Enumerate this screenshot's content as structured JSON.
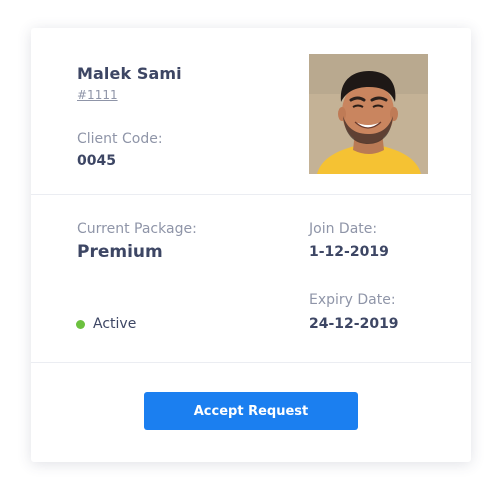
{
  "client": {
    "name": "Malek Sami",
    "id": "#1111",
    "code_label": "Client Code:",
    "code_value": "0045"
  },
  "package": {
    "label": "Current Package:",
    "value": "Premium"
  },
  "dates": {
    "join_label": "Join Date:",
    "join_value": "1-12-2019",
    "expiry_label": "Expiry Date:",
    "expiry_value": "24-12-2019"
  },
  "status": {
    "text": "Active",
    "color": "#6cc13f"
  },
  "actions": {
    "accept_label": "Accept Request",
    "accent_color": "#1b7ff0"
  }
}
